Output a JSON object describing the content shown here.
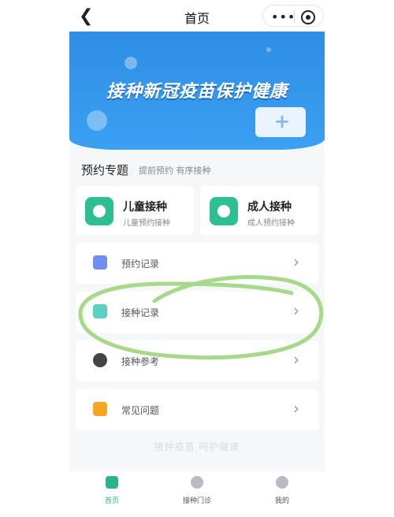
{
  "nav": {
    "title": "首页",
    "menu_dots": "•••"
  },
  "banner": {
    "text": "接种新冠疫苗保护健康",
    "indicator_count": 3,
    "active_index": 1
  },
  "section": {
    "title": "预约专题",
    "subtitle": "提前预约 有序接种"
  },
  "cards": [
    {
      "name": "儿童接种",
      "desc": "儿童预约接种",
      "icon": "child-icon",
      "color": "#2dbf8f"
    },
    {
      "name": "成人接种",
      "desc": "成人预约接种",
      "icon": "adult-icon",
      "color": "#2dbf8f"
    }
  ],
  "list": [
    {
      "label": "预约记录",
      "icon": "calendar-icon",
      "color": "#6f8ff3"
    },
    {
      "label": "接种记录",
      "icon": "record-icon",
      "color": "#5cd1c0"
    },
    {
      "label": "接种参考",
      "icon": "reference-icon",
      "color": "#444444"
    },
    {
      "label": "常见问题",
      "icon": "faq-icon",
      "color": "#f5a623"
    }
  ],
  "slogan": "接种疫苗 呵护健康",
  "tabs": [
    {
      "label": "首页",
      "icon": "home-icon",
      "active": true
    },
    {
      "label": "接种门诊",
      "icon": "clinic-icon",
      "active": false
    },
    {
      "label": "我的",
      "icon": "profile-icon",
      "active": false
    }
  ],
  "accent": "#29b48c",
  "annotation_color": "#a7d98a"
}
